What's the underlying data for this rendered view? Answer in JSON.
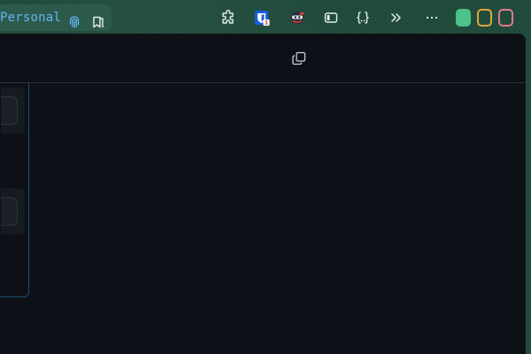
{
  "profile": {
    "label": "Personal",
    "icon": "fingerprint-icon"
  },
  "toolbar": {
    "icons": [
      "bookmark-icon",
      "puzzle-extensions-icon",
      "bitwarden-shield-icon",
      "ninja-extension-icon",
      "sidebar-toggle-icon",
      "json-braces-icon",
      "chevrons-right-icon",
      "more-dots-icon"
    ]
  },
  "window_controls": {
    "colors": [
      "#4cc38a",
      "#e0a43a",
      "#e07a8a"
    ]
  },
  "panel": {
    "header_icon": "copy-icon",
    "side_cards": 2
  },
  "colors": {
    "frame": "#1f4b3b",
    "panel_bg": "#0d1117",
    "accent_text": "#64b5f6",
    "side_border": "#1f4f72"
  }
}
